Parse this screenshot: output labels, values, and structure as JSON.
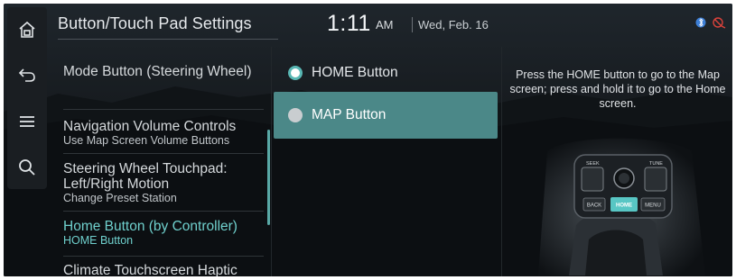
{
  "header": {
    "title": "Button/Touch Pad Settings",
    "time": "1:11",
    "ampm": "AM",
    "date": "Wed, Feb. 16"
  },
  "rail": [
    {
      "name": "home-icon"
    },
    {
      "name": "back-icon"
    },
    {
      "name": "menu-icon"
    },
    {
      "name": "search-icon"
    }
  ],
  "status_icons": [
    "bluetooth-phone-icon",
    "mute-icon"
  ],
  "settings_list": [
    {
      "label": "Mode Button (Steering Wheel)",
      "sub": ""
    },
    {
      "label": "Navigation Volume Controls",
      "sub": "Use Map Screen Volume Buttons"
    },
    {
      "label": "Steering Wheel Touchpad: Left/Right Motion",
      "sub": "Change Preset Station"
    },
    {
      "label": "Home Button (by Controller)",
      "sub": "HOME Button"
    },
    {
      "label": "Climate Touchscreen Haptic",
      "sub": ""
    }
  ],
  "options": [
    {
      "label": "HOME Button",
      "selected": true
    },
    {
      "label": "MAP Button",
      "selected": false
    }
  ],
  "description": "Press the HOME button to go to the Map screen; press and hold it to go to the Home screen.",
  "illustration": {
    "labels": {
      "top_left": "SEEK",
      "top_right": "TUNE",
      "back": "BACK",
      "home": "HOME",
      "menu": "MENU"
    }
  },
  "colors": {
    "accent": "#59b7b4",
    "highlight": "#4b8888",
    "active_text": "#6fd0cd",
    "background": "#0a0d10"
  }
}
